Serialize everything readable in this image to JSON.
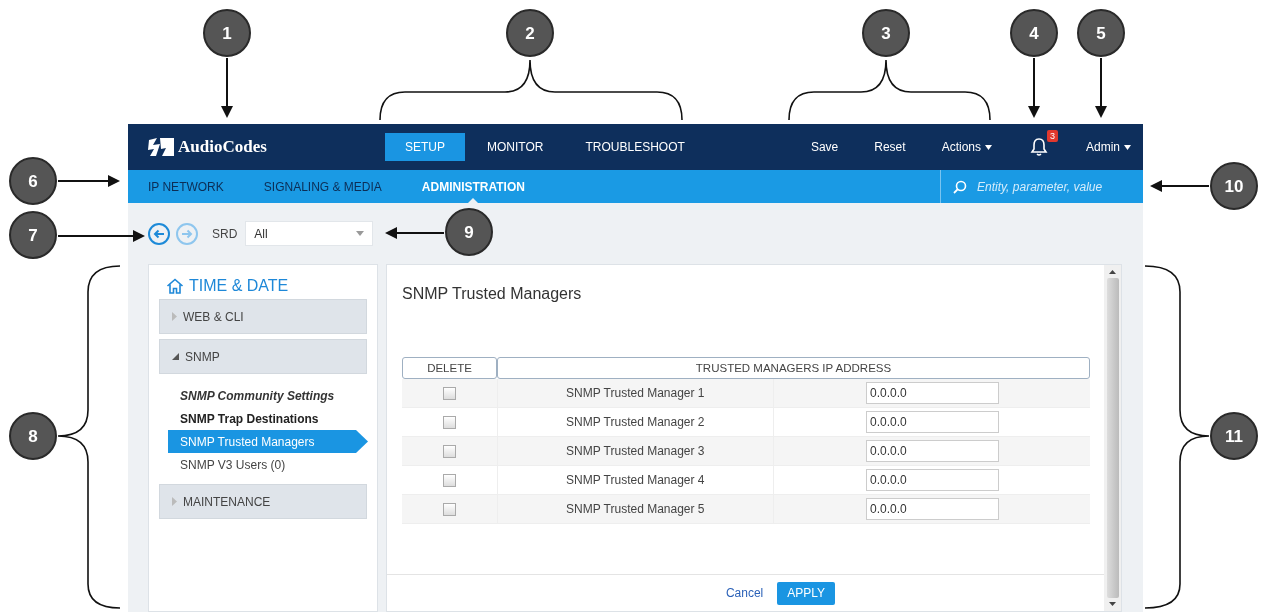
{
  "callouts": [
    {
      "label": "1"
    },
    {
      "label": "2"
    },
    {
      "label": "3"
    },
    {
      "label": "4"
    },
    {
      "label": "5"
    },
    {
      "label": "6"
    },
    {
      "label": "7"
    },
    {
      "label": "8"
    },
    {
      "label": "9"
    },
    {
      "label": "10"
    },
    {
      "label": "11"
    }
  ],
  "top_bar": {
    "logo": "AudioCodes",
    "tabs": [
      {
        "label": "SETUP",
        "selected": true
      },
      {
        "label": "MONITOR",
        "selected": false
      },
      {
        "label": "TROUBLESHOOT",
        "selected": false
      }
    ],
    "actions": [
      {
        "label": "Save",
        "kind": "plain"
      },
      {
        "label": "Reset",
        "kind": "plain"
      },
      {
        "label": "Actions",
        "kind": "menu"
      }
    ],
    "alerts": {
      "count": "3"
    },
    "user": {
      "label": "Admin"
    }
  },
  "nav_bar": {
    "items": [
      {
        "label": "IP NETWORK",
        "selected": false
      },
      {
        "label": "SIGNALING & MEDIA",
        "selected": false
      },
      {
        "label": "ADMINISTRATION",
        "selected": true
      }
    ],
    "search": {
      "placeholder": "Entity, parameter, value"
    }
  },
  "toolbar": {
    "nav_buttons": [
      {
        "kind": "back",
        "disabled": false
      },
      {
        "kind": "forward",
        "disabled": true
      }
    ],
    "srd_label": "SRD",
    "srd_value": "All"
  },
  "sidebar": {
    "title": "TIME & DATE",
    "groups": [
      {
        "label": "WEB & CLI",
        "expanded": false
      },
      {
        "label": "SNMP",
        "expanded": true,
        "children": [
          {
            "label": "SNMP Community Settings",
            "kind": "edited",
            "selected": false
          },
          {
            "label": "SNMP Trap Destinations",
            "kind": "bold",
            "selected": false
          },
          {
            "label": "SNMP Trusted Managers",
            "kind": "plain",
            "selected": true
          },
          {
            "label": "SNMP V3 Users (0)",
            "kind": "plain",
            "selected": false
          }
        ]
      },
      {
        "label": "MAINTENANCE",
        "expanded": false
      }
    ]
  },
  "page": {
    "title": "SNMP Trusted Managers",
    "table": {
      "columns": [
        "DELETE",
        "TRUSTED MANAGERS IP ADDRESS"
      ],
      "rows": [
        {
          "checked": false,
          "name": "SNMP Trusted Manager 1",
          "value": "0.0.0.0"
        },
        {
          "checked": false,
          "name": "SNMP Trusted Manager 2",
          "value": "0.0.0.0"
        },
        {
          "checked": false,
          "name": "SNMP Trusted Manager 3",
          "value": "0.0.0.0"
        },
        {
          "checked": false,
          "name": "SNMP Trusted Manager 4",
          "value": "0.0.0.0"
        },
        {
          "checked": false,
          "name": "SNMP Trusted Manager 5",
          "value": "0.0.0.0"
        }
      ]
    },
    "buttons": [
      {
        "label": "Cancel",
        "kind": "link"
      },
      {
        "label": "APPLY",
        "kind": "primary"
      }
    ]
  }
}
